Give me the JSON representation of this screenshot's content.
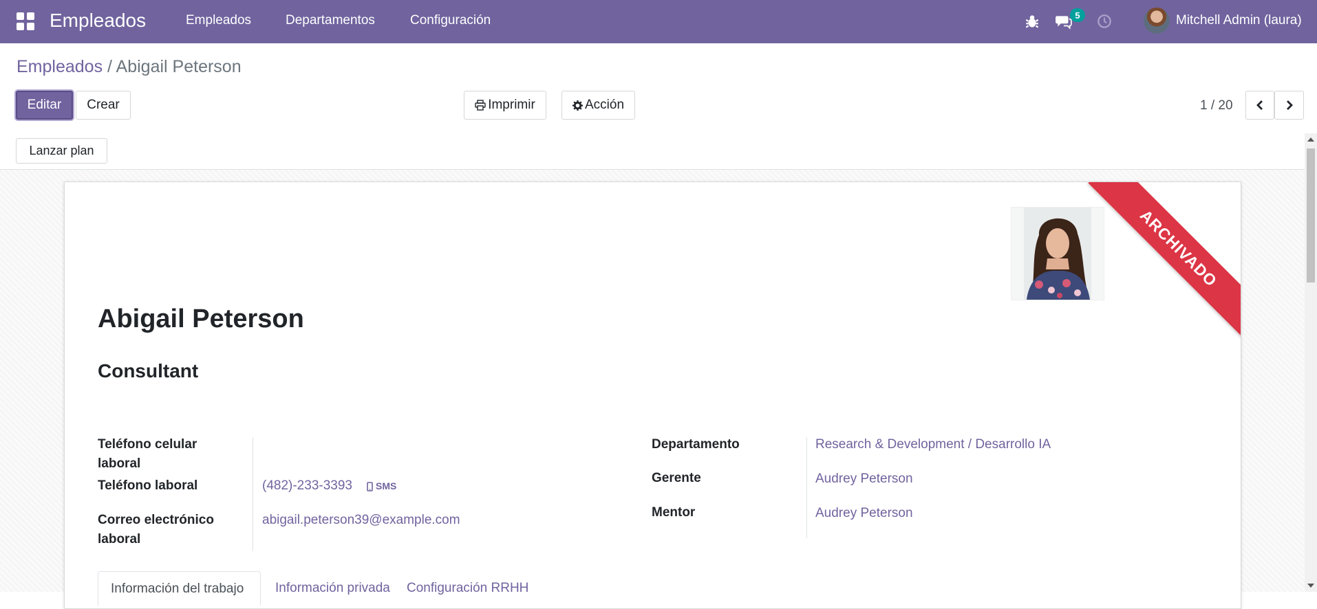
{
  "navbar": {
    "app_title": "Empleados",
    "menu": [
      "Empleados",
      "Departamentos",
      "Configuración"
    ],
    "messages_badge": "5",
    "user_name": "Mitchell Admin (laura)",
    "icons": [
      "apps-icon",
      "bug-icon",
      "chat-icon",
      "clock-icon",
      "avatar"
    ],
    "color": "#71639e"
  },
  "breadcrumb": {
    "parent": "Empleados",
    "separator": " / ",
    "current": "Abigail Peterson"
  },
  "actions": {
    "edit": "Editar",
    "create": "Crear",
    "print": "Imprimir",
    "action": "Acción"
  },
  "pager": {
    "value": "1 / 20"
  },
  "statusbar": {
    "launch_plan": "Lanzar plan"
  },
  "employee": {
    "ribbon": "ARCHIVADO",
    "name": "Abigail Peterson",
    "job_title": "Consultant",
    "left_fields": [
      {
        "label": "Teléfono celular laboral",
        "value": ""
      },
      {
        "label": "Teléfono laboral",
        "value": "(482)-233-3393",
        "sms": "SMS"
      },
      {
        "label": "Correo electrónico laboral",
        "value": "abigail.peterson39@example.com"
      }
    ],
    "right_fields": [
      {
        "label": "Departamento",
        "value": "Research & Development / Desarrollo IA"
      },
      {
        "label": "Gerente",
        "value": "Audrey Peterson"
      },
      {
        "label": "Mentor",
        "value": "Audrey Peterson"
      }
    ]
  },
  "tabs": [
    "Información del trabajo",
    "Información privada",
    "Configuración RRHH"
  ],
  "colors": {
    "primary": "#71639e",
    "ribbon": "#dc3545",
    "badge": "#00a09d"
  }
}
